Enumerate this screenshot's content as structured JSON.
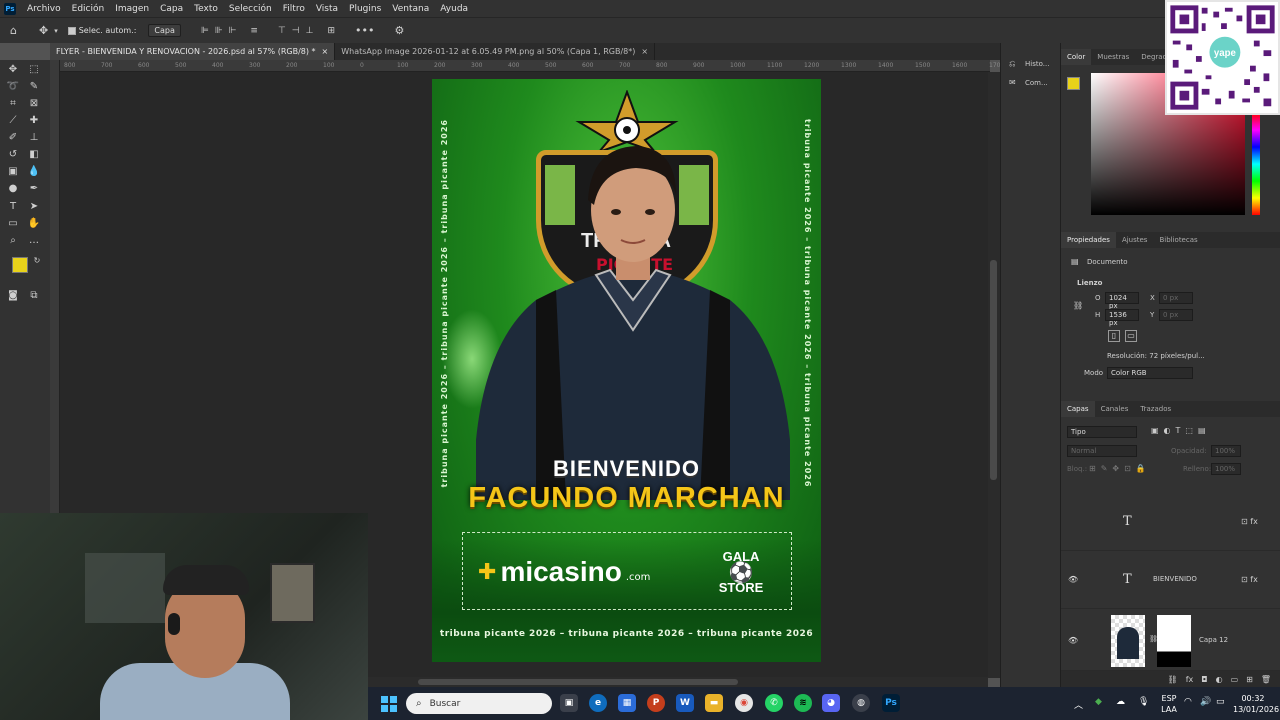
{
  "app": {
    "logo": "Ps"
  },
  "menu": [
    "Archivo",
    "Edición",
    "Imagen",
    "Capa",
    "Texto",
    "Selección",
    "Filtro",
    "Vista",
    "Plugins",
    "Ventana",
    "Ayuda"
  ],
  "options": {
    "auto_select_label": "Selec. autom.:",
    "auto_select_value": "Capa"
  },
  "tabs": [
    {
      "label": "FLYER - BIENVENIDA Y RENOVACION - 2026.psd al 57% (RGB/8) *",
      "active": true
    },
    {
      "label": "WhatsApp Image 2026-01-12 at 6.05.49 PM.png al 50% (Capa 1, RGB/8*)",
      "active": false
    }
  ],
  "ruler_ticks": [
    "800",
    "700",
    "600",
    "500",
    "400",
    "300",
    "200",
    "100",
    "0",
    "100",
    "200",
    "300",
    "400",
    "500",
    "600",
    "700",
    "800",
    "900",
    "1000",
    "1100",
    "1200",
    "1300",
    "1400",
    "1500",
    "1600",
    "1700",
    "1800"
  ],
  "flyer": {
    "side_text": "tribuna picante 2026 – tribuna picante 2026 – tribuna picante 2026",
    "shield_text": "TRIBUNA",
    "shield_sub": "PICANTE",
    "welcome": "BIENVENIDO",
    "name": "FACUNDO MARCHAN",
    "sponsor_1_main": "micasino",
    "sponsor_1_suffix": ".com",
    "sponsor_2_line1": "GALA",
    "sponsor_2_line2": "STORE",
    "bottom_text": "tribuna picante 2026 – tribuna picante 2026 – tribuna picante 2026"
  },
  "right_col": {
    "history": "Histo...",
    "comments": "Com..."
  },
  "color_panel": {
    "tabs": [
      "Color",
      "Muestras",
      "Degradados"
    ],
    "fg_color": "#e8d21a"
  },
  "props_panel": {
    "tabs": [
      "Propiedades",
      "Ajustes",
      "Bibliotecas"
    ],
    "doc_label": "Documento",
    "section": "Lienzo",
    "width_label": "O",
    "width": "1024 px",
    "height_label": "H",
    "height": "1536 px",
    "x_label": "X",
    "x_value": "0 px",
    "y_label": "Y",
    "y_value": "0 px",
    "resolution": "Resolución: 72 píxeles/pul...",
    "mode_label": "Modo",
    "mode": "Color RGB"
  },
  "layers_panel": {
    "tabs": [
      "Capas",
      "Canales",
      "Trazados"
    ],
    "filter": "Tipo",
    "blend": "Normal",
    "opacity_label": "Opacidad:",
    "opacity": "100%",
    "lock_label": "Bloq.:",
    "fill_label": "Relleno:",
    "fill": "100%",
    "layers": [
      {
        "name": "",
        "type": "text",
        "visible": false
      },
      {
        "name": "BIENVENIDO",
        "type": "text",
        "visible": true
      },
      {
        "name": "Capa 12",
        "type": "image",
        "visible": true
      }
    ]
  },
  "taskbar": {
    "search_placeholder": "Buscar",
    "lang_1": "ESP",
    "lang_2": "LAA",
    "time": "00:32",
    "date": "13/01/2026"
  },
  "qr": {
    "brand": "yape"
  }
}
